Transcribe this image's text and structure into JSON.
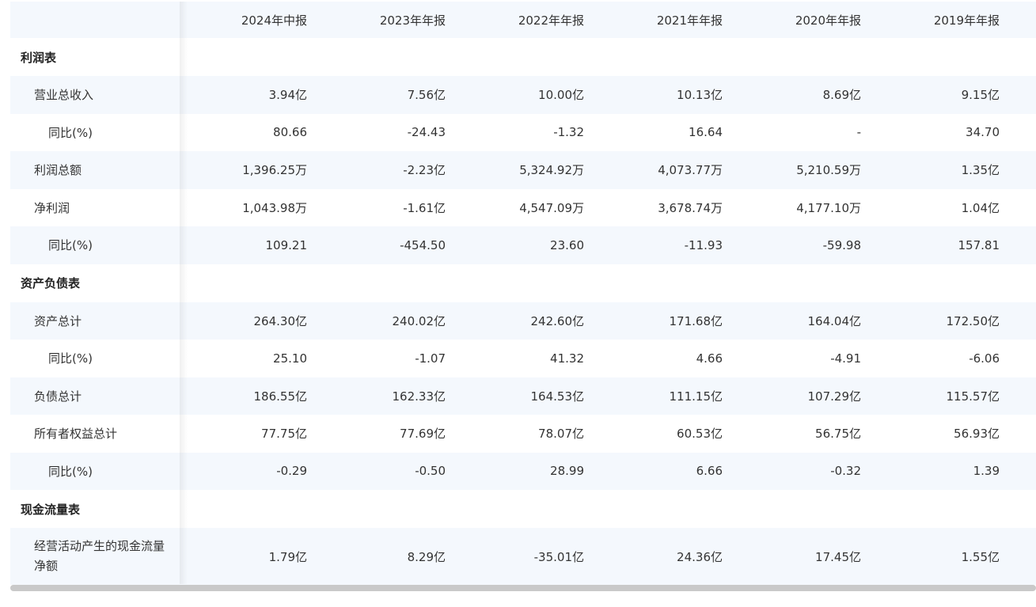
{
  "columns": [
    "2024年中报",
    "2023年年报",
    "2022年年报",
    "2021年年报",
    "2020年年报",
    "2019年年报"
  ],
  "sections": [
    {
      "title": "利润表",
      "rows": [
        {
          "label": "营业总收入",
          "level": 1,
          "values": [
            "3.94亿",
            "7.56亿",
            "10.00亿",
            "10.13亿",
            "8.69亿",
            "9.15亿"
          ]
        },
        {
          "label": "同比(%)",
          "level": 2,
          "values": [
            "80.66",
            "-24.43",
            "-1.32",
            "16.64",
            "-",
            "34.70"
          ]
        },
        {
          "label": "利润总额",
          "level": 1,
          "values": [
            "1,396.25万",
            "-2.23亿",
            "5,324.92万",
            "4,073.77万",
            "5,210.59万",
            "1.35亿"
          ]
        },
        {
          "label": "净利润",
          "level": 1,
          "values": [
            "1,043.98万",
            "-1.61亿",
            "4,547.09万",
            "3,678.74万",
            "4,177.10万",
            "1.04亿"
          ]
        },
        {
          "label": "同比(%)",
          "level": 2,
          "values": [
            "109.21",
            "-454.50",
            "23.60",
            "-11.93",
            "-59.98",
            "157.81"
          ]
        }
      ]
    },
    {
      "title": "资产负债表",
      "rows": [
        {
          "label": "资产总计",
          "level": 1,
          "values": [
            "264.30亿",
            "240.02亿",
            "242.60亿",
            "171.68亿",
            "164.04亿",
            "172.50亿"
          ]
        },
        {
          "label": "同比(%)",
          "level": 2,
          "values": [
            "25.10",
            "-1.07",
            "41.32",
            "4.66",
            "-4.91",
            "-6.06"
          ]
        },
        {
          "label": "负债总计",
          "level": 1,
          "values": [
            "186.55亿",
            "162.33亿",
            "164.53亿",
            "111.15亿",
            "107.29亿",
            "115.57亿"
          ]
        },
        {
          "label": "所有者权益总计",
          "level": 1,
          "values": [
            "77.75亿",
            "77.69亿",
            "78.07亿",
            "60.53亿",
            "56.75亿",
            "56.93亿"
          ]
        },
        {
          "label": "同比(%)",
          "level": 2,
          "values": [
            "-0.29",
            "-0.50",
            "28.99",
            "6.66",
            "-0.32",
            "1.39"
          ]
        }
      ]
    },
    {
      "title": "现金流量表",
      "rows": [
        {
          "label": "经营活动产生的现金流量净额",
          "level": 1,
          "multiline": true,
          "values": [
            "1.79亿",
            "8.29亿",
            "-35.01亿",
            "24.36亿",
            "17.45亿",
            "1.55亿"
          ]
        }
      ]
    }
  ],
  "colors": {
    "header_bg": "#f4f8fd",
    "alt_row_bg": "#f4f8fd",
    "text": "#333333"
  }
}
